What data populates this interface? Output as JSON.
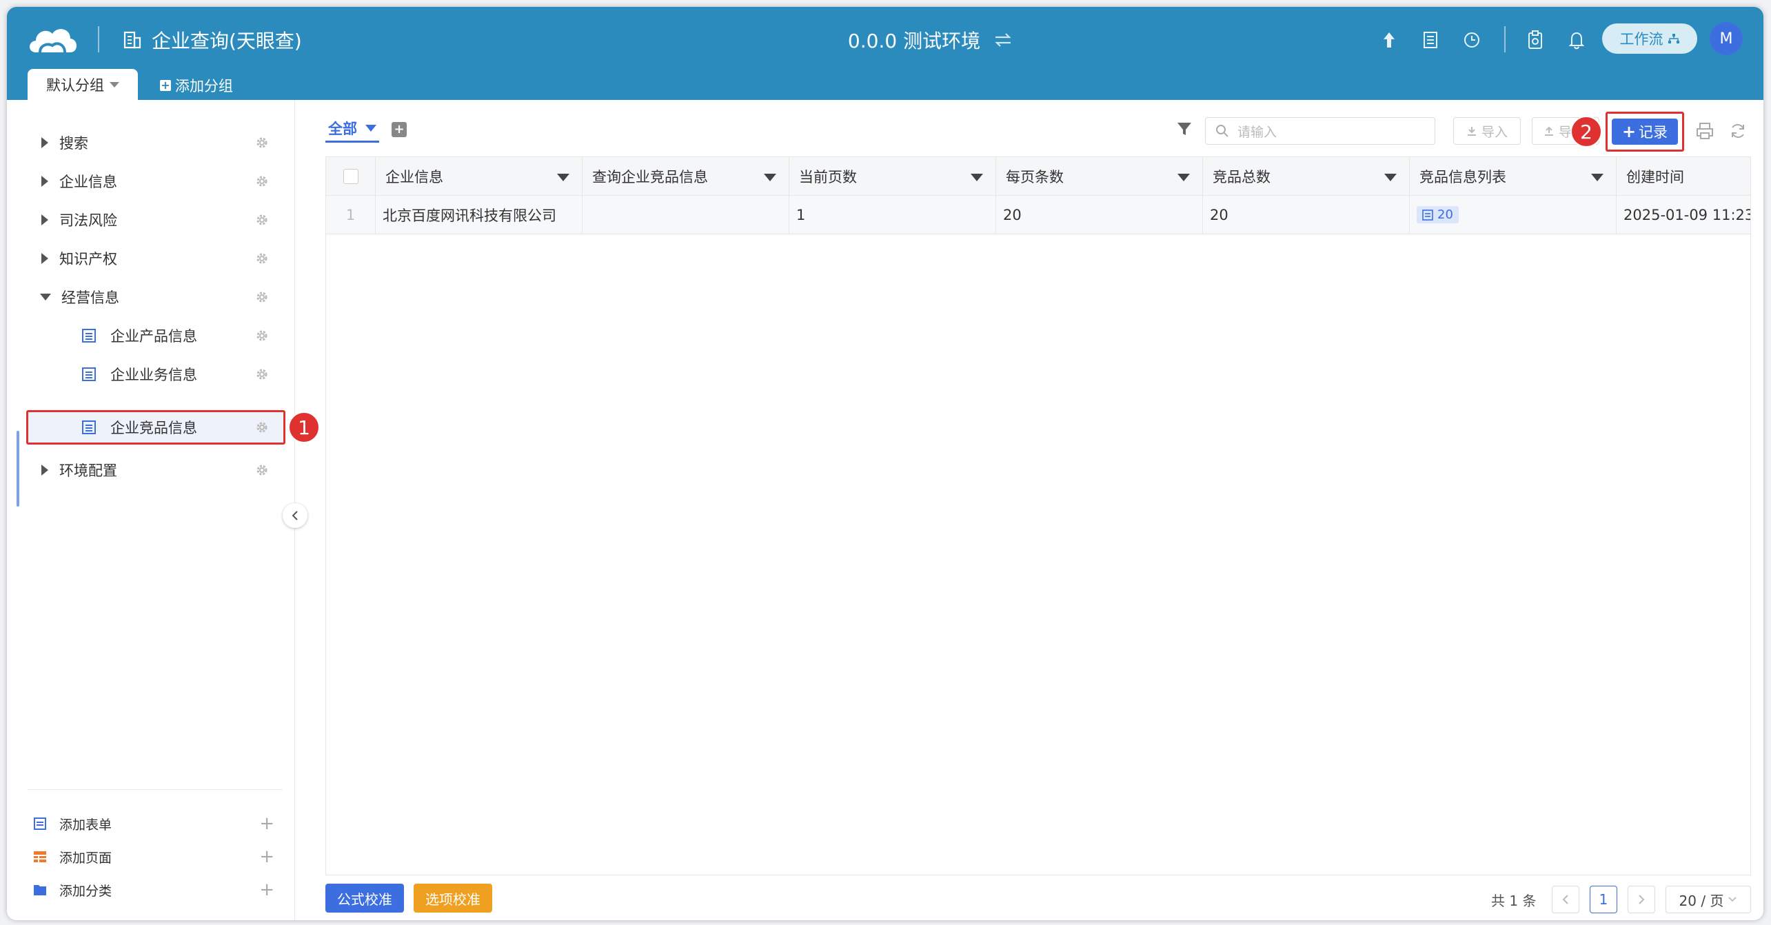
{
  "header": {
    "app_title": "企业查询(天眼查)",
    "env_title": "0.0.0 测试环境",
    "workflow_label": "工作流",
    "avatar_initial": "M",
    "group_tab": "默认分组",
    "add_group": "添加分组",
    "bg_color": "#2b8bbd"
  },
  "sidebar": {
    "items": [
      {
        "label": "搜索"
      },
      {
        "label": "企业信息"
      },
      {
        "label": "司法风险"
      },
      {
        "label": "知识产权"
      },
      {
        "label": "经营信息"
      },
      {
        "label": "企业产品信息"
      },
      {
        "label": "企业业务信息"
      },
      {
        "label": "企业竞品信息"
      },
      {
        "label": "环境配置"
      }
    ],
    "footer": {
      "add_form": "添加表单",
      "add_page": "添加页面",
      "add_category": "添加分类"
    }
  },
  "annotations": {
    "one": "1",
    "two": "2"
  },
  "toolbar": {
    "view_tab": "全部",
    "search_placeholder": "请输入",
    "import_label": "导入",
    "export_label": "导",
    "record_label": "记录"
  },
  "table": {
    "columns": [
      "企业信息",
      "查询企业竞品信息",
      "当前页数",
      "每页条数",
      "竞品总数",
      "竞品信息列表",
      "创建时间"
    ],
    "rows": [
      {
        "index": "1",
        "company": "北京百度网讯科技有限公司",
        "query": "",
        "page": "1",
        "per_page": "20",
        "total": "20",
        "list_count": "20",
        "created": "2025-01-09 11:23:"
      }
    ]
  },
  "footer": {
    "formula_btn": "公式校准",
    "option_btn": "选项校准",
    "total_text": "共 1 条",
    "current_page": "1",
    "page_size": "20 / 页"
  },
  "colors": {
    "accent": "#3c6ee0",
    "danger": "#e03131",
    "warning": "#f0a020"
  }
}
